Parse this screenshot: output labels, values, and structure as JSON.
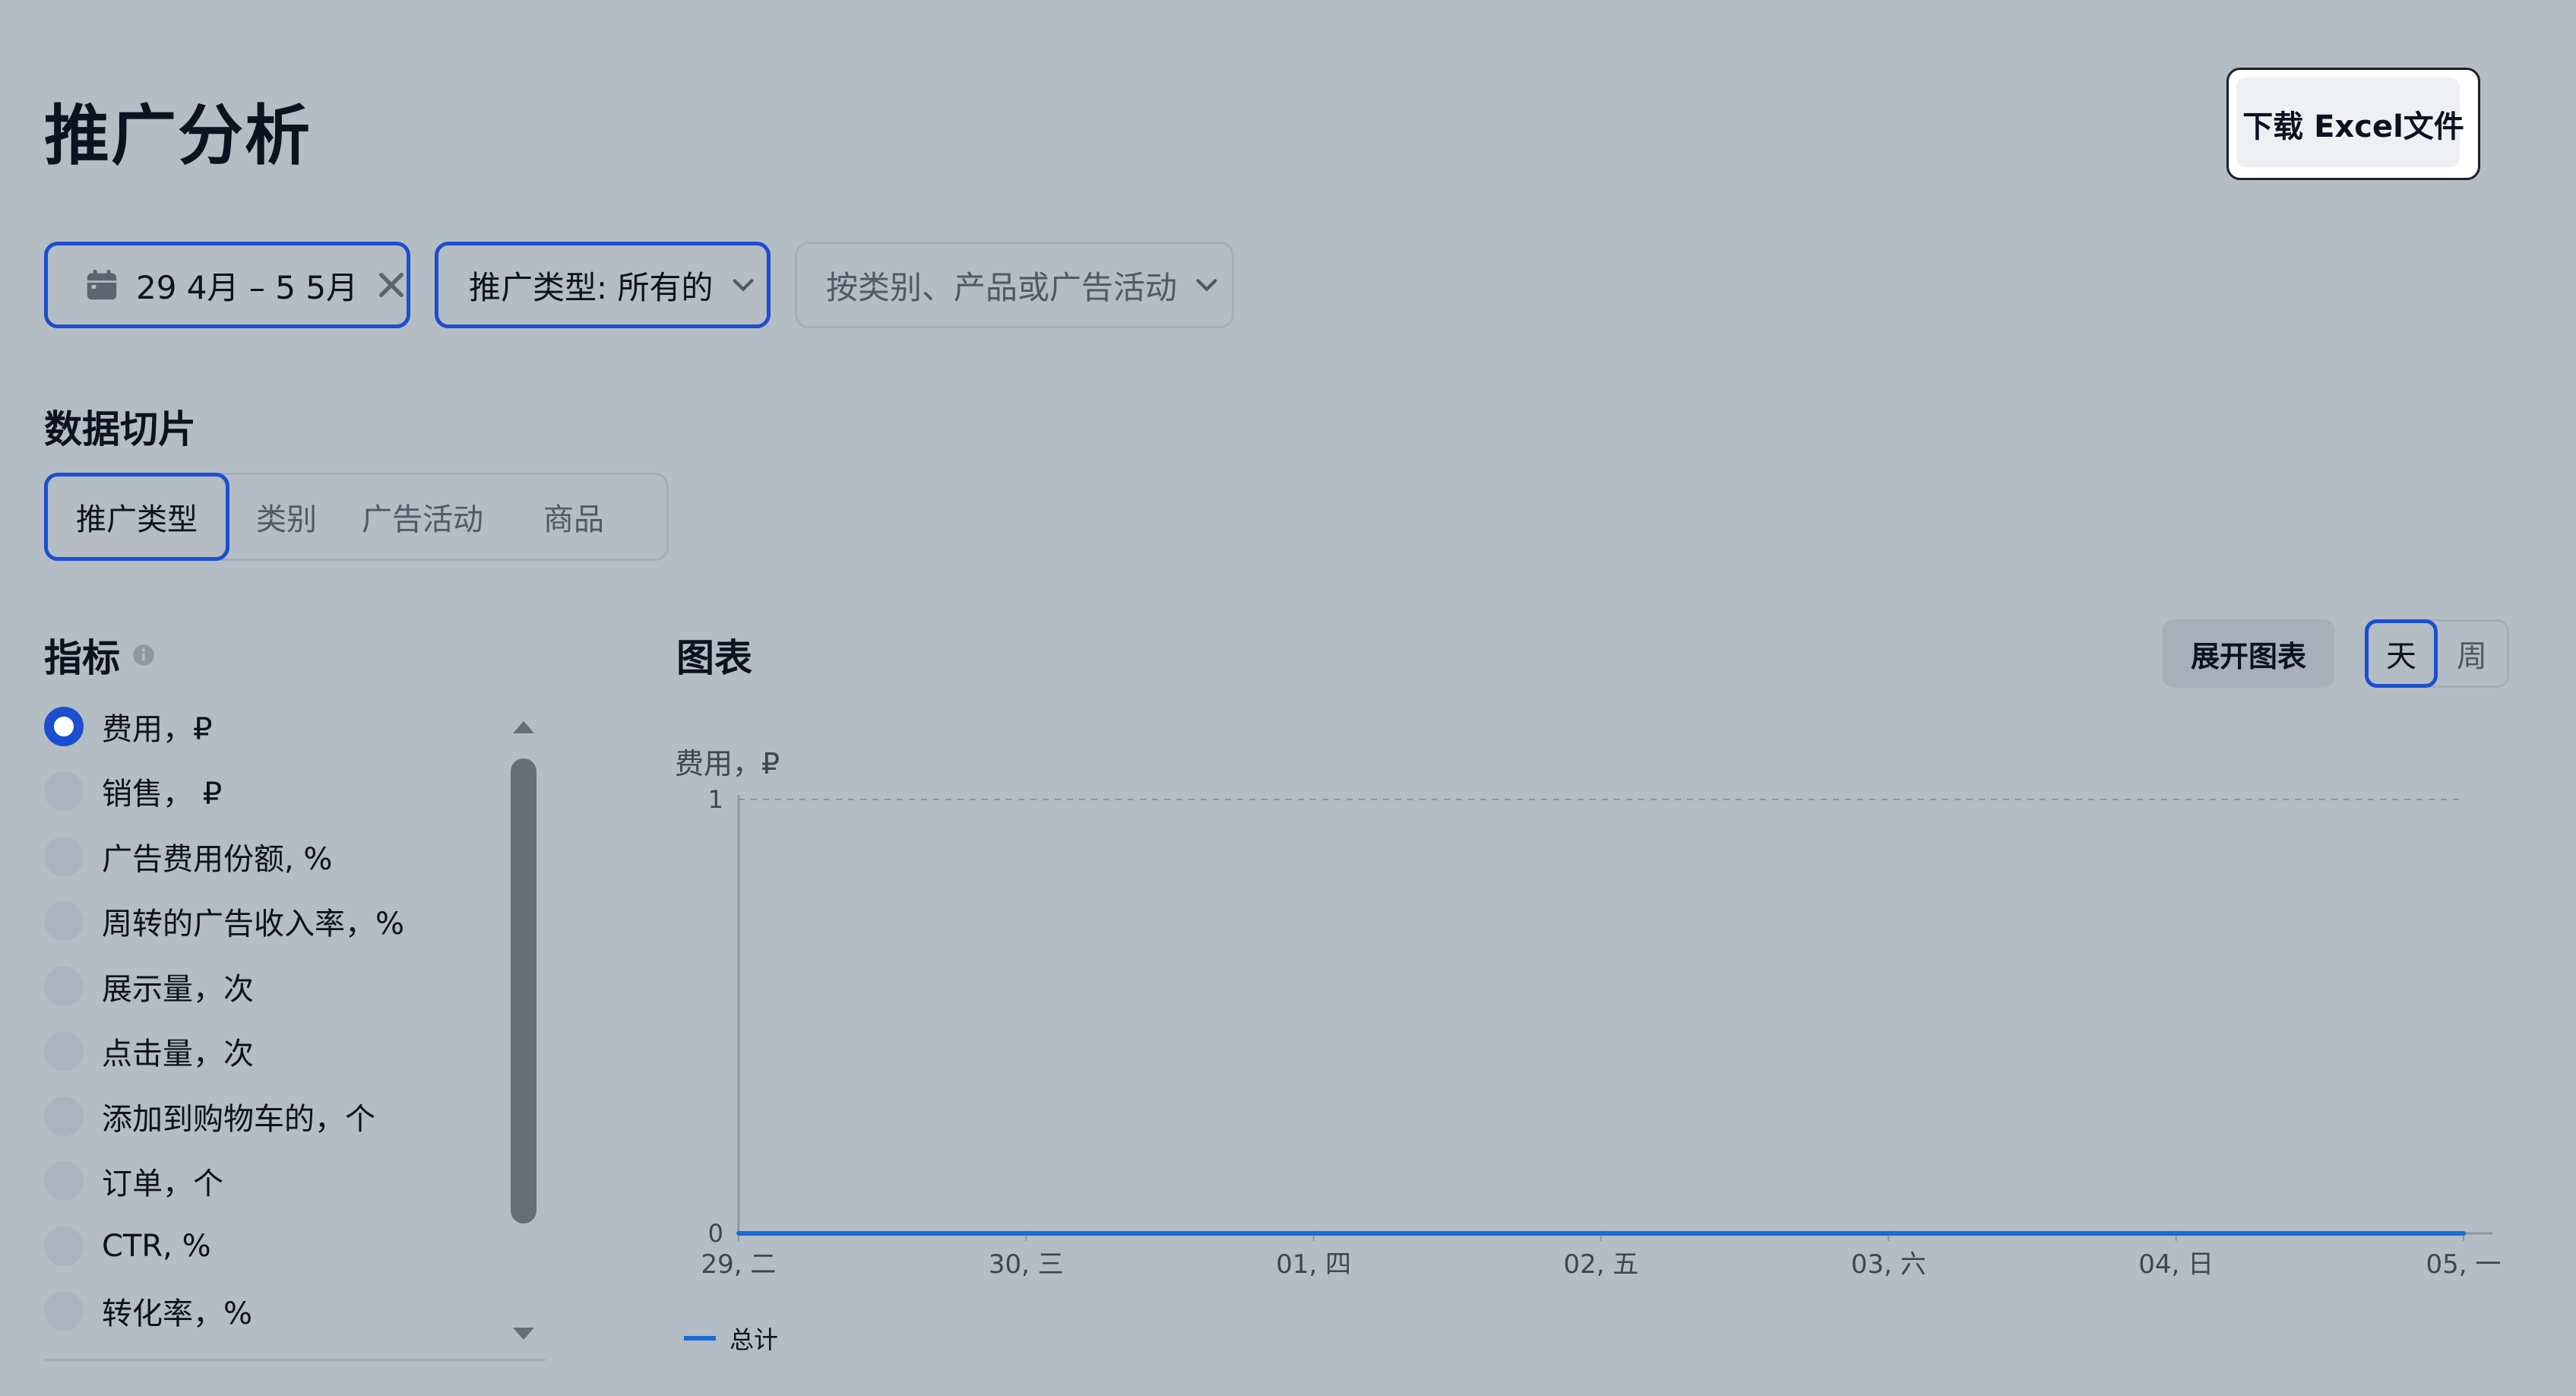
{
  "page": {
    "title": "推广分析",
    "download_label": "下载 Excel文件"
  },
  "filters": {
    "date_range": "29 4月 – 5 5月",
    "promo_type": "推广类型: 所有的",
    "category_placeholder": "按类别、产品或广告活动"
  },
  "slice": {
    "title": "数据切片",
    "tabs": [
      "推广类型",
      "类别",
      "广告活动",
      "商品"
    ],
    "active_tab": "推广类型"
  },
  "metrics": {
    "title": "指标",
    "items": [
      {
        "label": "费用，₽",
        "selected": true
      },
      {
        "label": "销售， ₽",
        "selected": false
      },
      {
        "label": "广告费用份额, %",
        "selected": false
      },
      {
        "label": "周转的广告收入率，%",
        "selected": false
      },
      {
        "label": "展示量，次",
        "selected": false
      },
      {
        "label": "点击量，次",
        "selected": false
      },
      {
        "label": "添加到购物车的，个",
        "selected": false
      },
      {
        "label": "订单，个",
        "selected": false
      },
      {
        "label": "CTR, %",
        "selected": false
      },
      {
        "label": "转化率，%",
        "selected": false
      }
    ]
  },
  "chart_panel": {
    "title": "图表",
    "expand_label": "展开图表",
    "period_day": "天",
    "period_week": "周",
    "active_period": "天"
  },
  "colors": {
    "accent": "#1b4fcf",
    "series_line": "#1b6bd1",
    "background": "#b4bcc4"
  },
  "chart_data": {
    "type": "line",
    "ylabel": "费用，₽",
    "x": [
      "29, 二",
      "30, 三",
      "01, 四",
      "02, 五",
      "03, 六",
      "04, 日",
      "05, 一"
    ],
    "ylim": [
      0,
      1
    ],
    "yticks": [
      0,
      1
    ],
    "series": [
      {
        "name": "总计",
        "values": [
          0,
          0,
          0,
          0,
          0,
          0,
          0
        ]
      }
    ],
    "legend": "bottom-left",
    "grid": "dashed at top"
  }
}
